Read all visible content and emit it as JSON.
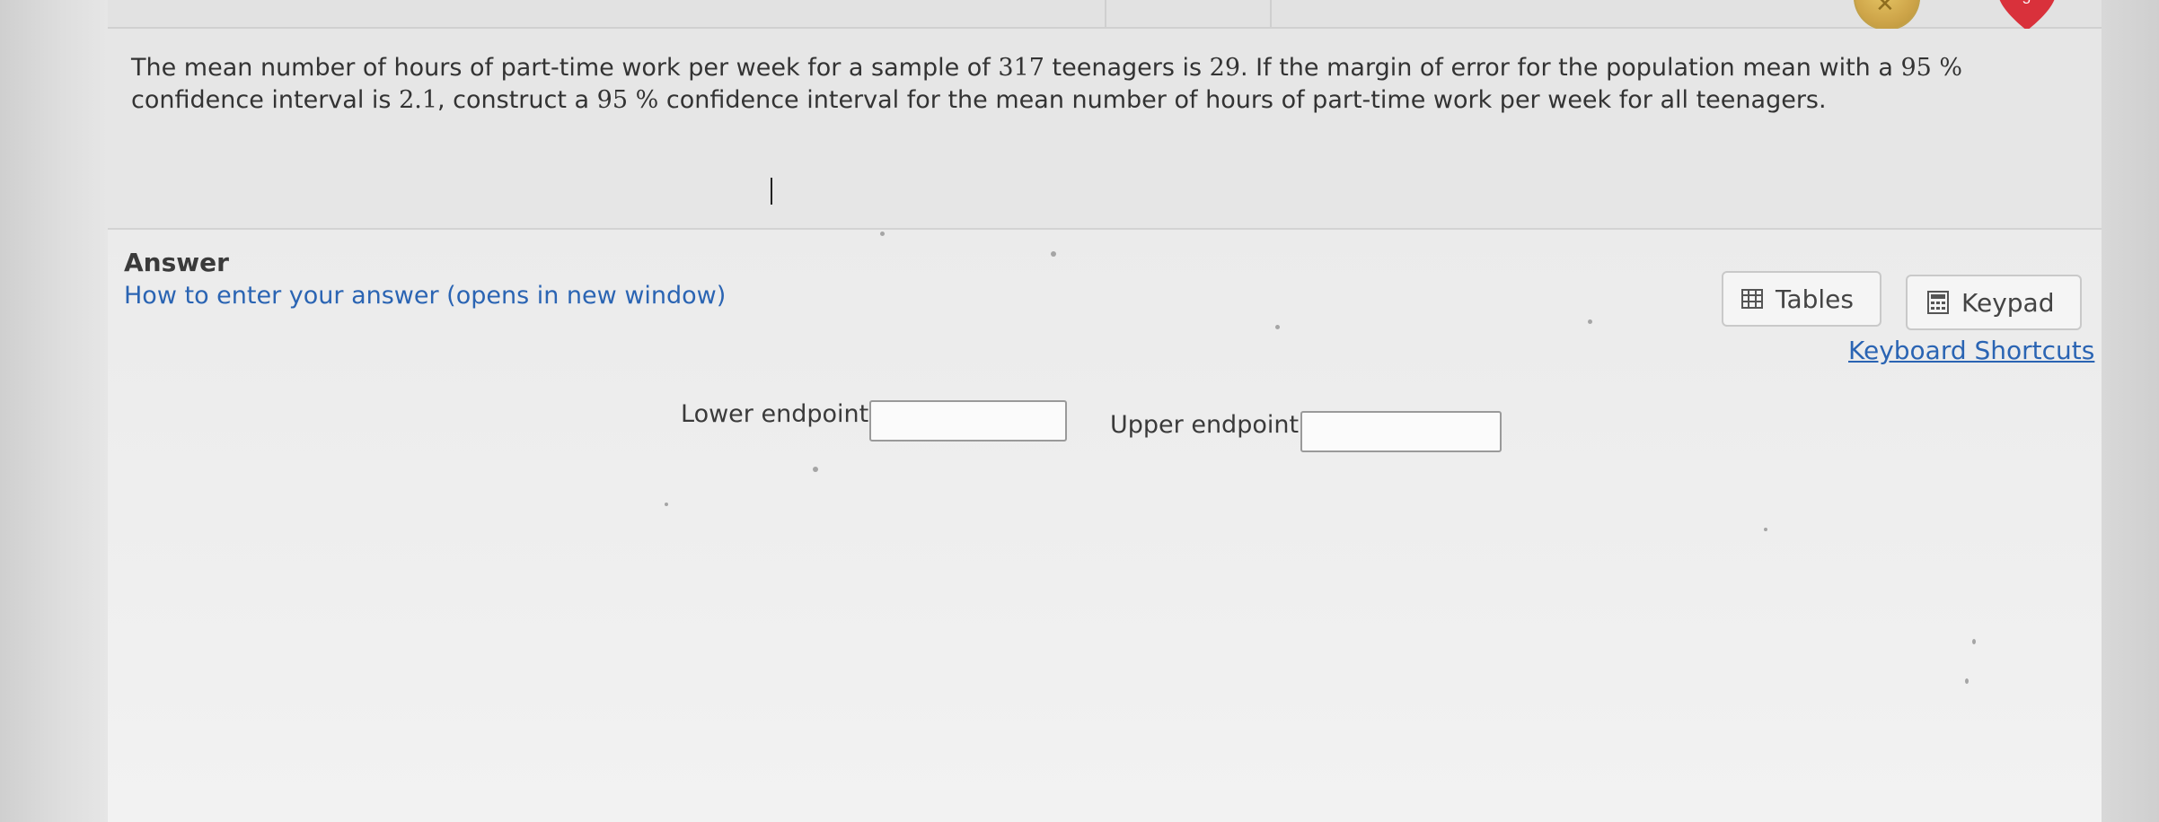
{
  "question": {
    "segments": [
      {
        "t": "text",
        "v": "The mean number of hours of part-time work per week for a sample of "
      },
      {
        "t": "num",
        "v": "317"
      },
      {
        "t": "text",
        "v": " teenagers is "
      },
      {
        "t": "num",
        "v": "29"
      },
      {
        "t": "text",
        "v": ".  If the margin of error for the population mean with a "
      },
      {
        "t": "num",
        "v": "95 %"
      },
      {
        "t": "text",
        "v": "  confidence interval is "
      },
      {
        "t": "num",
        "v": "2.1"
      },
      {
        "t": "text",
        "v": ", construct a "
      },
      {
        "t": "num",
        "v": "95 %"
      },
      {
        "t": "text",
        "v": "  confidence interval for the mean number of hours of part-time work per week for all teenagers."
      }
    ]
  },
  "answer": {
    "heading": "Answer",
    "how_to_link": "How to enter your answer (opens in new window)"
  },
  "tools": {
    "tables_label": "Tables",
    "keypad_label": "Keypad",
    "shortcuts_label": "Keyboard Shortcuts"
  },
  "fields": {
    "lower_label": "Lower endpoint:",
    "lower_value": "",
    "upper_label": "Upper endpoint:",
    "upper_value": ""
  },
  "icons": {
    "tables": "table-grid-icon",
    "keypad": "calculator-icon",
    "coin": "coin-icon",
    "heart": "heart-icon"
  },
  "colors": {
    "link": "#2a64b3",
    "text": "#333333",
    "heart": "#d9313b",
    "coin": "#cfa64a"
  }
}
